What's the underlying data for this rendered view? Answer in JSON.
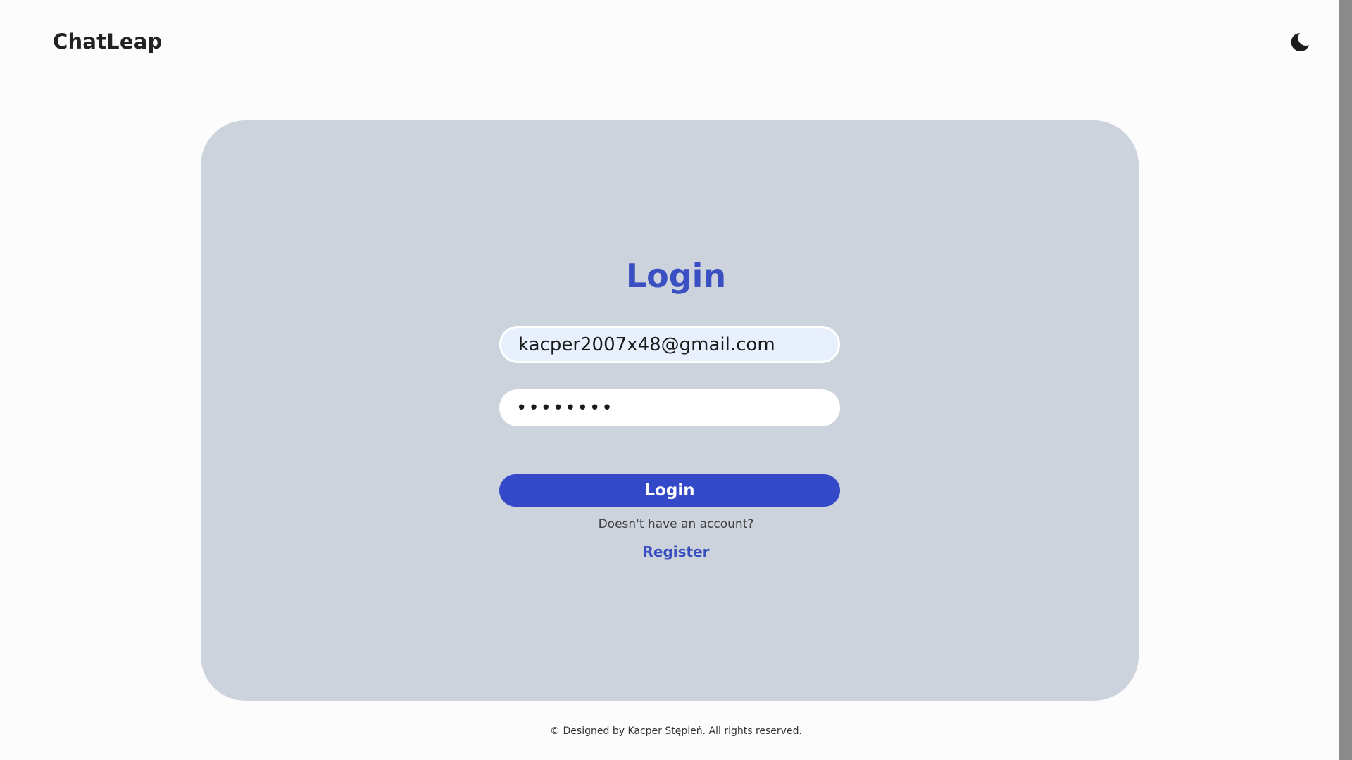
{
  "header": {
    "brand": "ChatLeap",
    "theme_toggle_icon": "moon-icon"
  },
  "login_form": {
    "title": "Login",
    "email_value": "kacper2007x48@gmail.com",
    "password_value": "••••••••",
    "submit_label": "Login",
    "no_account_text": "Doesn't have an account?",
    "register_link": "Register"
  },
  "footer": {
    "text": "© Designed by Kacper Stępień. All rights reserved."
  },
  "colors": {
    "accent": "#3449c8",
    "card_background": "#cdd3dc",
    "email_autofill_background": "#e8f0fe"
  }
}
